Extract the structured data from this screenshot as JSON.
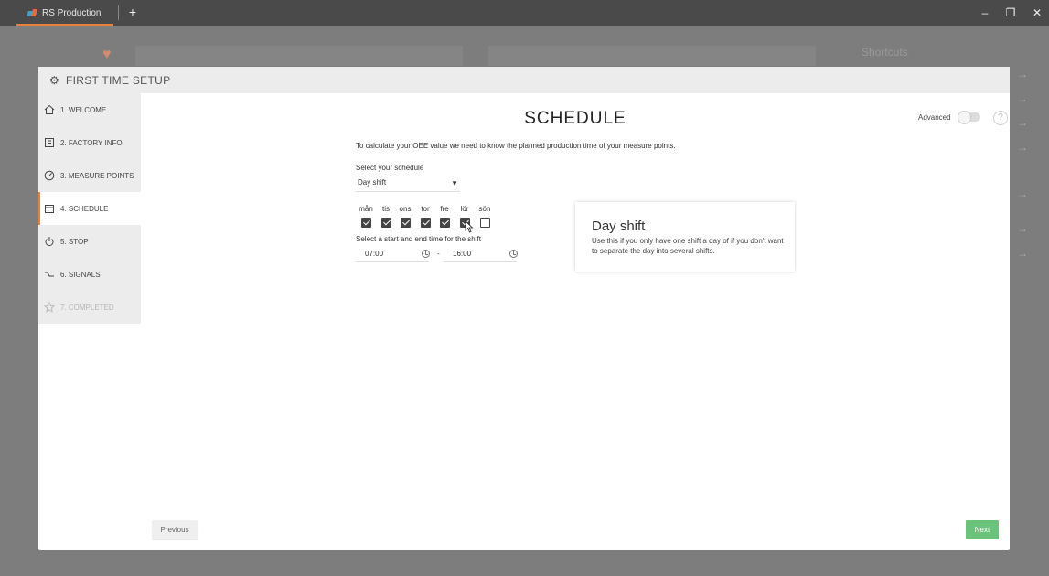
{
  "window": {
    "tab_title": "RS Production",
    "new_tab": "+",
    "minimize": "–",
    "maximize": "❐",
    "close": "✕"
  },
  "background": {
    "shortcuts": "Shortcuts"
  },
  "dialog": {
    "title": "FIRST TIME SETUP",
    "nav": [
      {
        "label": "1. WELCOME",
        "icon": "home-icon"
      },
      {
        "label": "2. FACTORY INFO",
        "icon": "factory-icon"
      },
      {
        "label": "3. MEASURE POINTS",
        "icon": "gauge-icon"
      },
      {
        "label": "4. SCHEDULE",
        "icon": "calendar-icon"
      },
      {
        "label": "5. STOP",
        "icon": "power-icon"
      },
      {
        "label": "6. SIGNALS",
        "icon": "signal-icon"
      },
      {
        "label": "7. COMPLETED",
        "icon": "star-icon"
      }
    ],
    "active_step": "4. SCHEDULE",
    "heading": "SCHEDULE",
    "advanced_label": "Advanced",
    "advanced_enabled": false,
    "help": "?",
    "intro": "To calculate your OEE value we need to know the planned production time of your measure points.",
    "schedule_label": "Select your schedule",
    "schedule_value": "Day shift",
    "days": [
      {
        "label": "mån",
        "checked": true
      },
      {
        "label": "tis",
        "checked": true
      },
      {
        "label": "ons",
        "checked": true
      },
      {
        "label": "tor",
        "checked": true
      },
      {
        "label": "fre",
        "checked": true
      },
      {
        "label": "lör",
        "checked": true
      },
      {
        "label": "sön",
        "checked": false
      }
    ],
    "time_label": "Select a start and end time for the shift",
    "start_time": "07:00",
    "separator": "-",
    "end_time": "16:00",
    "info_title": "Day shift",
    "info_text": "Use this if you only have one shift a day of if you don't want to separate the day into several shifts.",
    "previous": "Previous",
    "next": "Next"
  },
  "colors": {
    "accent": "#e8823b",
    "next_button": "#6ac37a"
  }
}
